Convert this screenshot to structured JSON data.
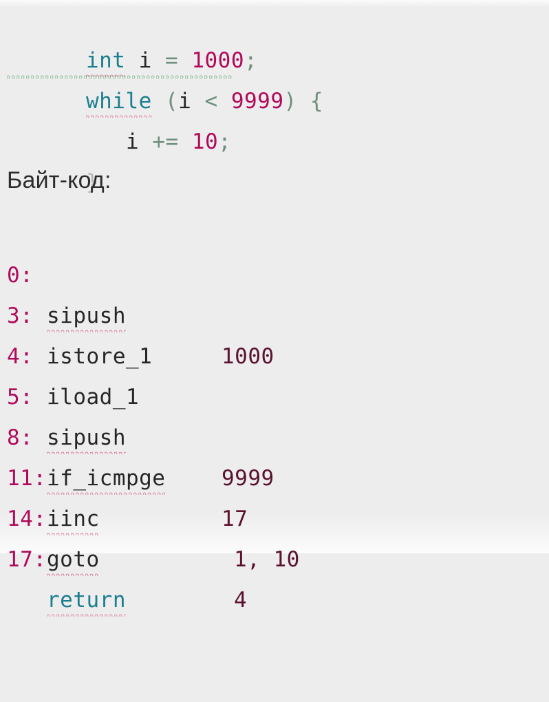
{
  "document": {
    "background_color": "#eeedee",
    "source_code": {
      "lines": [
        {
          "id": "line-declaration",
          "tokens": [
            {
              "text": "int",
              "kind": "keyword",
              "spell_error": true
            },
            {
              "text": " ",
              "kind": "space"
            },
            {
              "text": "i",
              "kind": "identifier"
            },
            {
              "text": " ",
              "kind": "space"
            },
            {
              "text": "=",
              "kind": "operator"
            },
            {
              "text": " ",
              "kind": "space"
            },
            {
              "text": "1000",
              "kind": "number"
            },
            {
              "text": ";",
              "kind": "punct"
            }
          ],
          "plain": "int i = 1000;"
        },
        {
          "id": "line-while",
          "grammar_error": true,
          "tokens": [
            {
              "text": "while",
              "kind": "keyword",
              "spell_error": true
            },
            {
              "text": " ",
              "kind": "space"
            },
            {
              "text": "(",
              "kind": "punct"
            },
            {
              "text": "i",
              "kind": "identifier"
            },
            {
              "text": " ",
              "kind": "space"
            },
            {
              "text": "<",
              "kind": "operator"
            },
            {
              "text": " ",
              "kind": "space"
            },
            {
              "text": "9999",
              "kind": "number"
            },
            {
              "text": ")",
              "kind": "punct"
            },
            {
              "text": " ",
              "kind": "space"
            },
            {
              "text": "{",
              "kind": "punct"
            }
          ],
          "plain": "while (i < 9999) {"
        },
        {
          "id": "line-increment",
          "indent": 3,
          "tokens": [
            {
              "text": "i",
              "kind": "identifier"
            },
            {
              "text": " ",
              "kind": "space"
            },
            {
              "text": "+=",
              "kind": "operator"
            },
            {
              "text": " ",
              "kind": "space"
            },
            {
              "text": "10",
              "kind": "number"
            },
            {
              "text": ";",
              "kind": "punct"
            }
          ],
          "plain": "   i += 10;"
        },
        {
          "id": "line-close-brace",
          "tokens": [
            {
              "text": "}",
              "kind": "brace-dim"
            }
          ],
          "plain": "}"
        }
      ]
    },
    "section_heading": "Байт-код:",
    "bytecode": {
      "rows": [
        {
          "offset": "0:",
          "opcode": "sipush",
          "operand": "1000",
          "spell_error": true,
          "keyword": false,
          "operand_indent": 322
        },
        {
          "offset": "3:",
          "opcode": "istore_1",
          "operand": "",
          "spell_error": false,
          "keyword": false,
          "operand_indent": 322
        },
        {
          "offset": "4:",
          "opcode": "iload_1",
          "operand": "",
          "spell_error": false,
          "keyword": false,
          "operand_indent": 322
        },
        {
          "offset": "5:",
          "opcode": "sipush",
          "operand": "9999",
          "spell_error": true,
          "keyword": false,
          "operand_indent": 322
        },
        {
          "offset": "8:",
          "opcode": "if_icmpge",
          "operand": "17",
          "spell_error": true,
          "keyword": false,
          "operand_indent": 322
        },
        {
          "offset": "11:",
          "opcode": "iinc",
          "operand": "1, 10",
          "spell_error": true,
          "keyword": false,
          "operand_indent": 340
        },
        {
          "offset": "14:",
          "opcode": "goto",
          "operand": "4",
          "spell_error": true,
          "keyword": false,
          "operand_indent": 340
        },
        {
          "offset": "17:",
          "opcode": "return",
          "operand": "",
          "spell_error": true,
          "keyword": true,
          "operand_indent": 322
        }
      ]
    },
    "colors": {
      "keyword": "#1a7f8e",
      "number": "#b00a5a",
      "identifier": "#262626",
      "punctuation": "#6e8f7a",
      "offset_label": "#b00a5a",
      "spell_squiggle": "#d4607f",
      "grammar_squiggle": "#4f9e63",
      "heading_text": "#2c2c2c",
      "background": "#eeedee"
    }
  }
}
